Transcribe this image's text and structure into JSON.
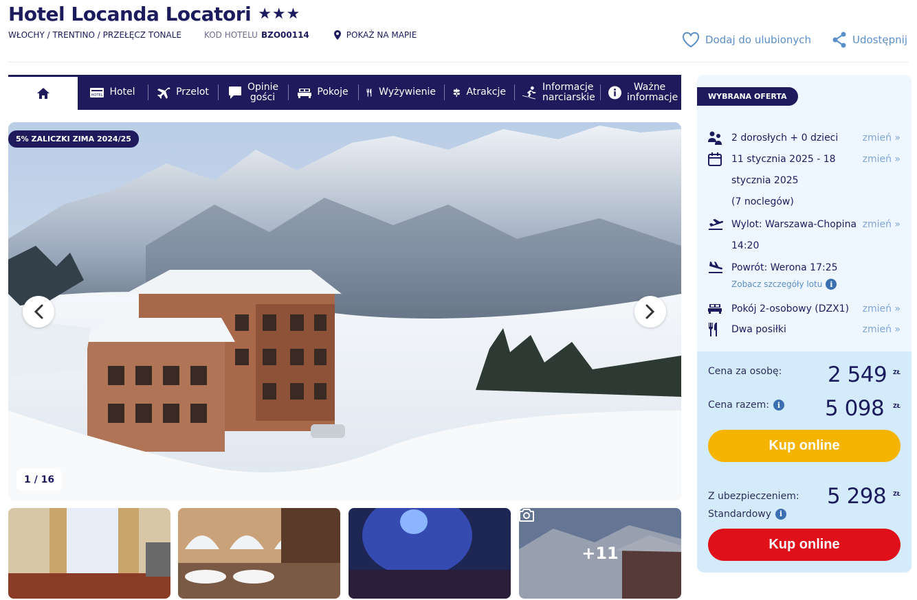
{
  "header": {
    "hotel_name": "Hotel Locanda Locatori",
    "stars": "★★★",
    "location": "WŁOCHY / TRENTINO / PRZEŁĘCZ TONALE",
    "code_label": "KOD HOTELU",
    "code_value": "BZO00114",
    "map_label": "POKAŻ NA MAPIE",
    "favorite_label": "Dodaj do ulubionych",
    "share_label": "Udostępnij"
  },
  "nav": {
    "items": [
      {
        "label": "Hotel"
      },
      {
        "label": "Przelot"
      },
      {
        "label": "Opinie gości"
      },
      {
        "label": "Pokoje"
      },
      {
        "label": "Wyżywienie"
      },
      {
        "label": "Atrakcje"
      },
      {
        "label": "Informacje narciarskie"
      },
      {
        "label": "Ważne informacje"
      }
    ]
  },
  "gallery": {
    "promo_badge": "5% ZALICZKI ZIMA 2024/25",
    "counter": "1 / 16",
    "more_photos": "+11"
  },
  "offer": {
    "badge": "WYBRANA OFERTA",
    "change_label": "zmień »",
    "travelers": "2 dorosłych + 0 dzieci",
    "dates_line1": "11 stycznia 2025 - 18",
    "dates_line2": "stycznia 2025",
    "nights": "(7 noclegów)",
    "departure_line1": "Wylot: Warszawa-Chopina",
    "departure_line2": "14:20",
    "return": "Powrót: Werona 17:25",
    "flight_details": "Zobacz szczegóły lotu",
    "room": "Pokój 2-osobowy (DZX1)",
    "board": "Dwa posiłki"
  },
  "pricing": {
    "per_person_label": "Cena za osobę:",
    "per_person_value": "2 549",
    "total_label": "Cena razem:",
    "total_value": "5 098",
    "currency": "ZŁ",
    "buy_label": "Kup online",
    "insured_label_line1": "Z ubezpieczeniem:",
    "insured_label_line2": "Standardowy",
    "insured_value": "5 298",
    "buy_label_2": "Kup online"
  },
  "colors": {
    "brand_navy": "#1f1a5c",
    "link_blue": "#5b8fc8",
    "buy_yellow": "#f5b400",
    "buy_red": "#e0101a",
    "panel_bg": "#eef6ff",
    "price_bg": "#d4ebfb"
  }
}
